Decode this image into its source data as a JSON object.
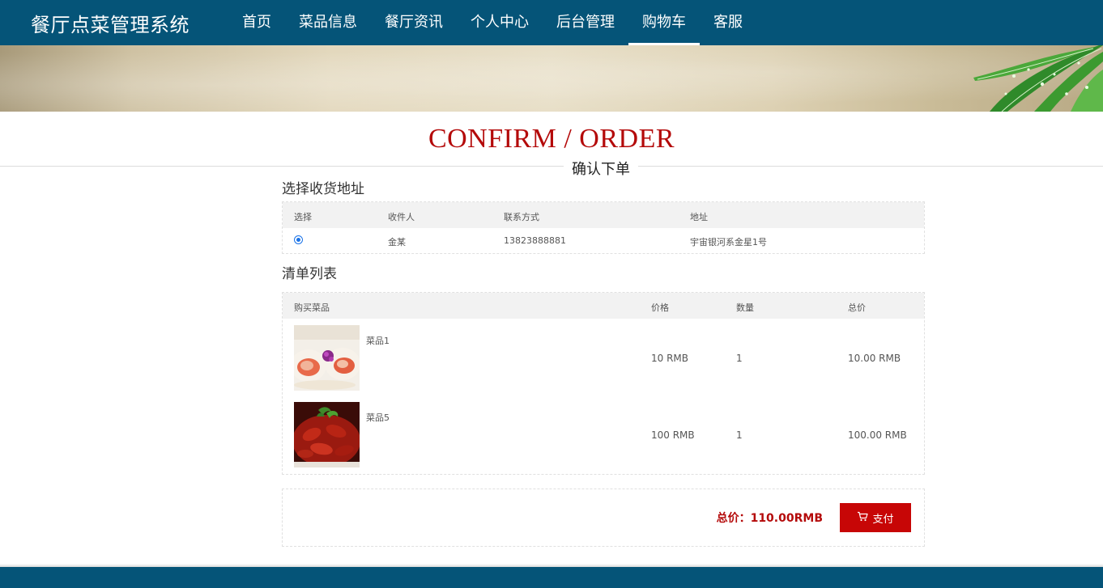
{
  "brand": "餐厅点菜管理系统",
  "nav": [
    "首页",
    "菜品信息",
    "餐厅资讯",
    "个人中心",
    "后台管理",
    "购物车",
    "客服"
  ],
  "nav_active": "购物车",
  "title": {
    "en": "CONFIRM / ORDER",
    "cn": "确认下单"
  },
  "address_section": {
    "label": "选择收货地址",
    "headers": [
      "选择",
      "收件人",
      "联系方式",
      "地址"
    ],
    "rows": [
      {
        "selected": true,
        "name": "金某",
        "phone": "13823888881",
        "address": "宇宙银河系金星1号"
      }
    ]
  },
  "list_section": {
    "label": "清单列表",
    "headers": [
      "购买菜品",
      "价格",
      "数量",
      "总价"
    ],
    "items": [
      {
        "name": "菜品1",
        "price": "10 RMB",
        "qty": "1",
        "total": "10.00 RMB",
        "image": "scallop-dish-image"
      },
      {
        "name": "菜品5",
        "price": "100 RMB",
        "qty": "1",
        "total": "100.00 RMB",
        "image": "crayfish-dish-image"
      }
    ]
  },
  "summary": {
    "total_label": "总价：110.00RMB",
    "pay_label": "支付",
    "pay_icon": "cart-icon"
  },
  "colors": {
    "header_bg": "#055478",
    "accent_red": "#b40a0a",
    "button_red": "#c70606"
  }
}
